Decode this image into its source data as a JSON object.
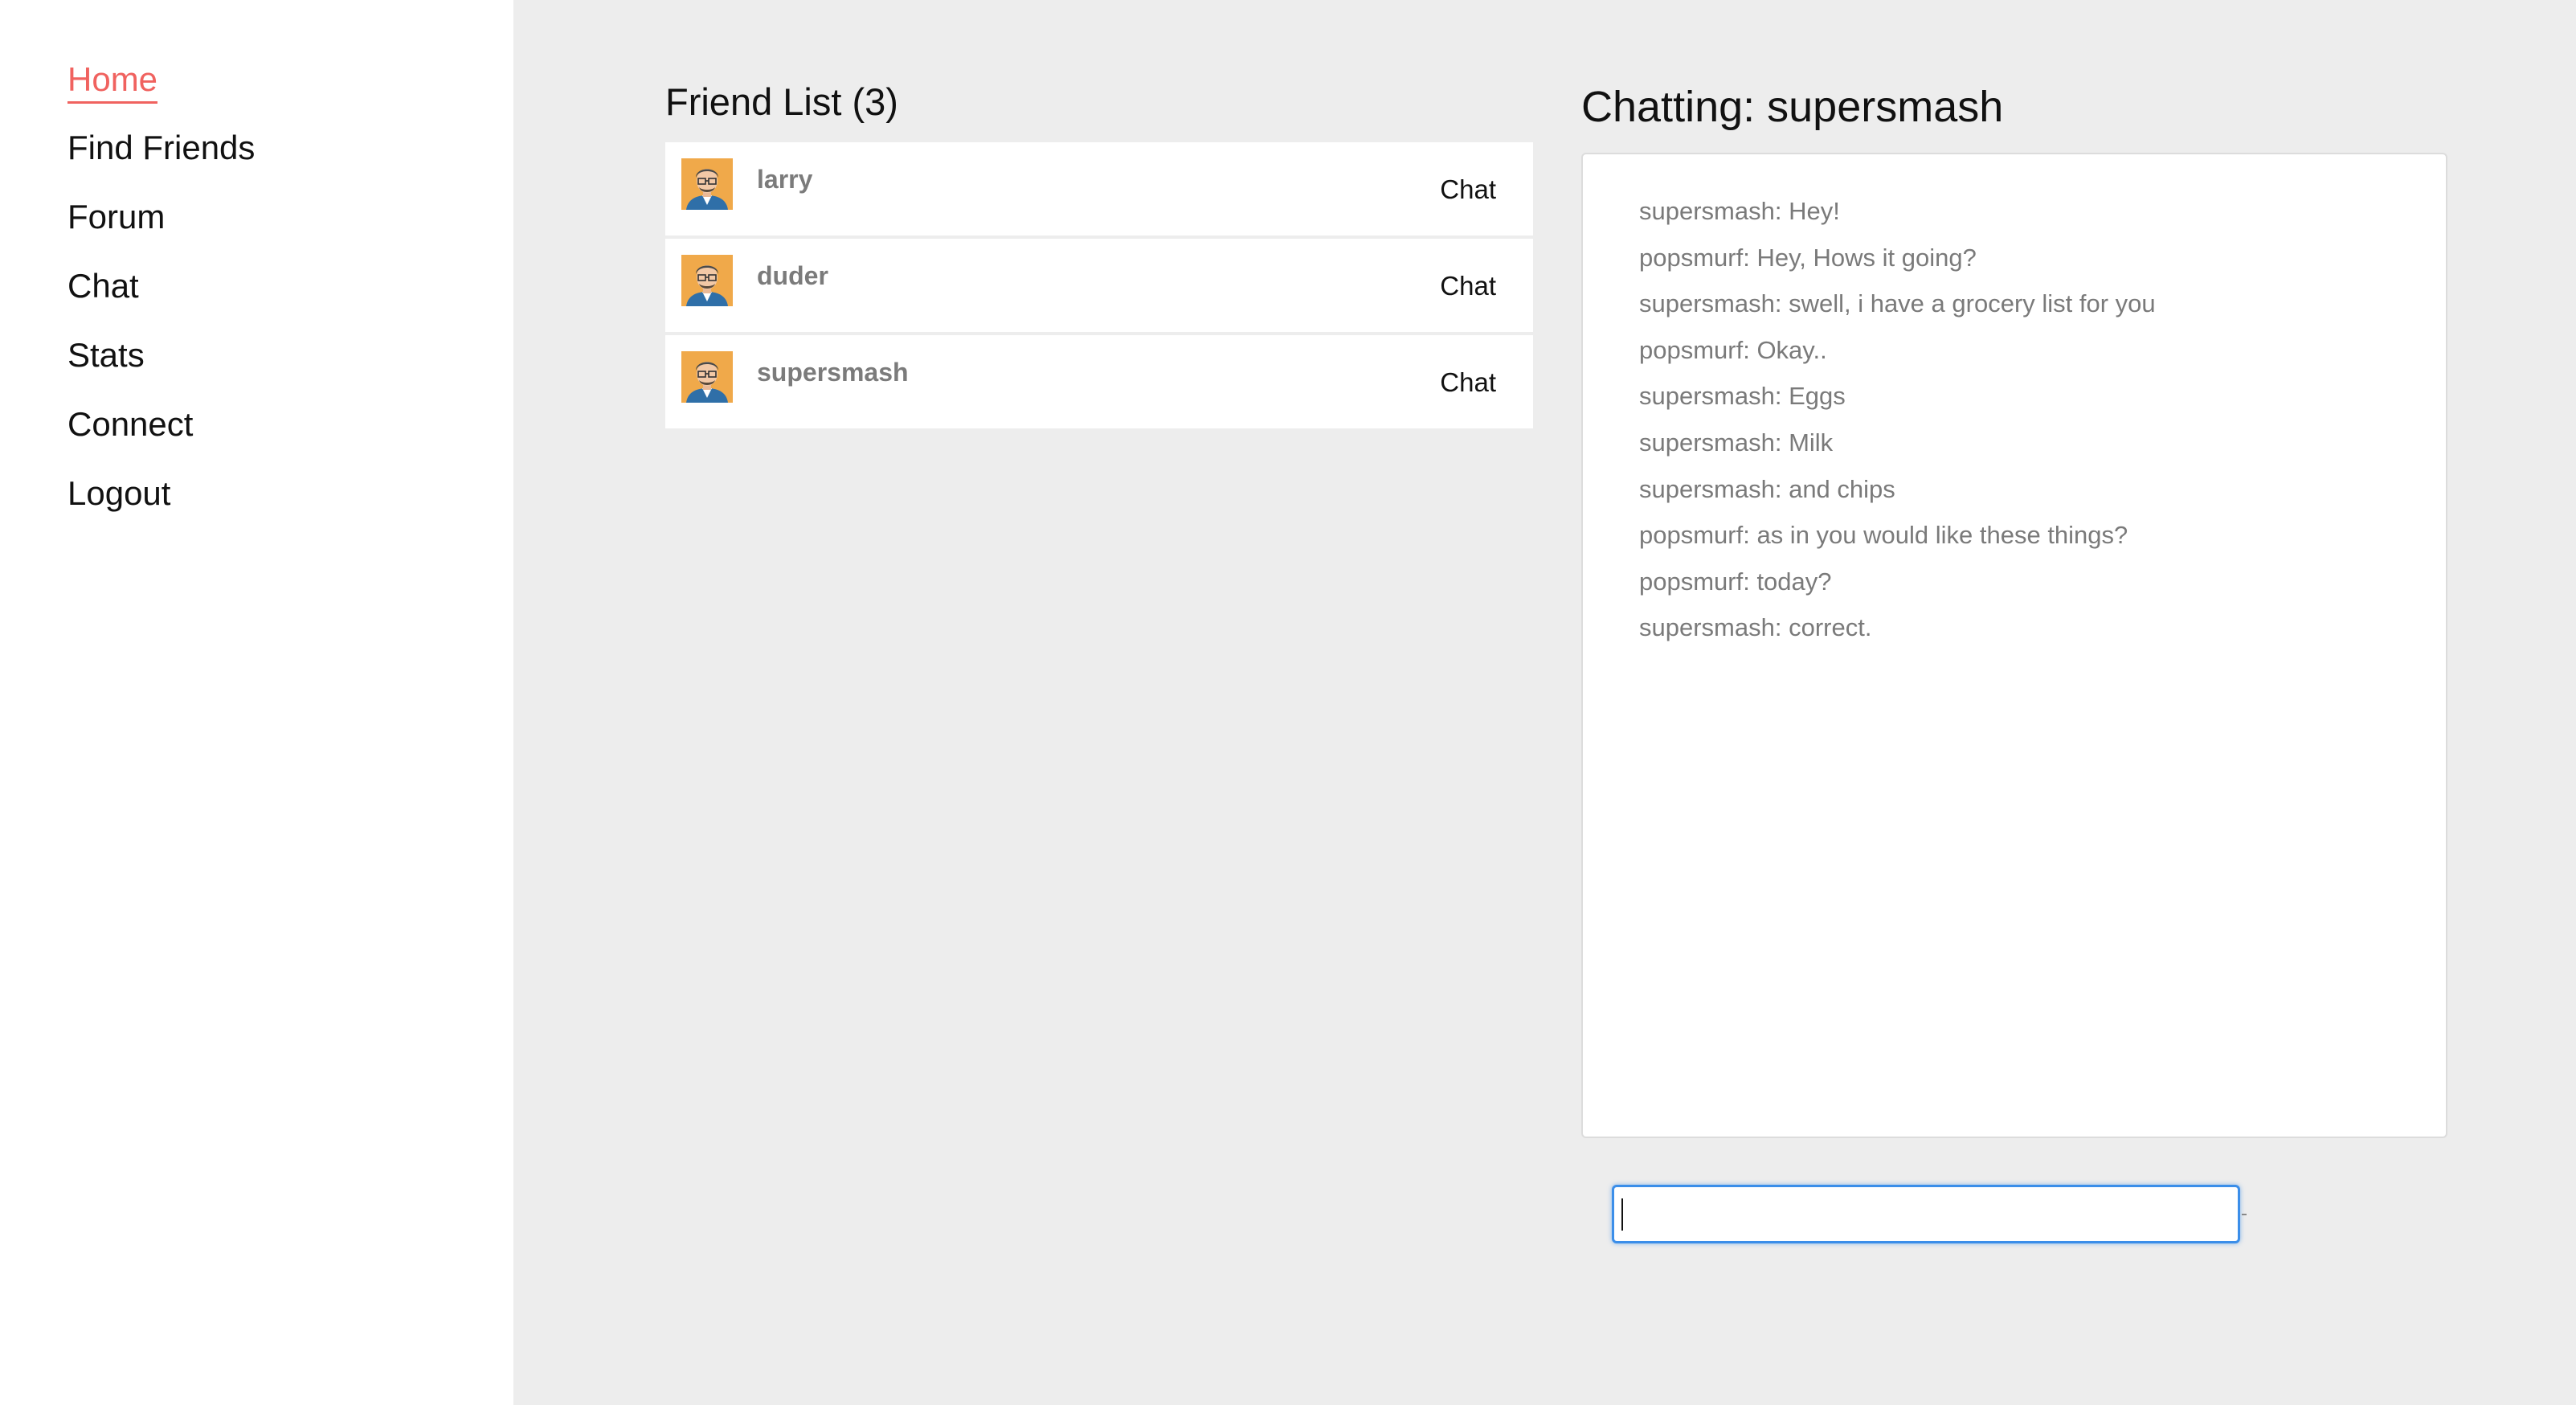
{
  "sidebar": {
    "items": [
      {
        "label": "Home",
        "active": true
      },
      {
        "label": "Find Friends"
      },
      {
        "label": "Forum"
      },
      {
        "label": "Chat"
      },
      {
        "label": "Stats"
      },
      {
        "label": "Connect"
      },
      {
        "label": "Logout"
      }
    ]
  },
  "friends": {
    "title": "Friend List (3)",
    "list": [
      {
        "name": "larry",
        "action": "Chat",
        "avatar_icon": "user-avatar-icon"
      },
      {
        "name": "duder",
        "action": "Chat",
        "avatar_icon": "user-avatar-icon"
      },
      {
        "name": "supersmash",
        "action": "Chat",
        "avatar_icon": "user-avatar-icon"
      }
    ]
  },
  "chat": {
    "title": "Chatting: supersmash",
    "messages": [
      "supersmash: Hey!",
      "popsmurf: Hey, Hows it going?",
      "supersmash: swell, i have a grocery list for you",
      "popsmurf: Okay..",
      "supersmash: Eggs",
      "supersmash: Milk",
      "supersmash: and chips",
      "popsmurf: as in you would like these things?",
      "popsmurf: today?",
      "supersmash: correct."
    ],
    "input": {
      "value": "",
      "placeholder": ""
    }
  },
  "colors": {
    "accent": "#f0625f",
    "background": "#ededed",
    "focus": "#3b8ee9"
  }
}
